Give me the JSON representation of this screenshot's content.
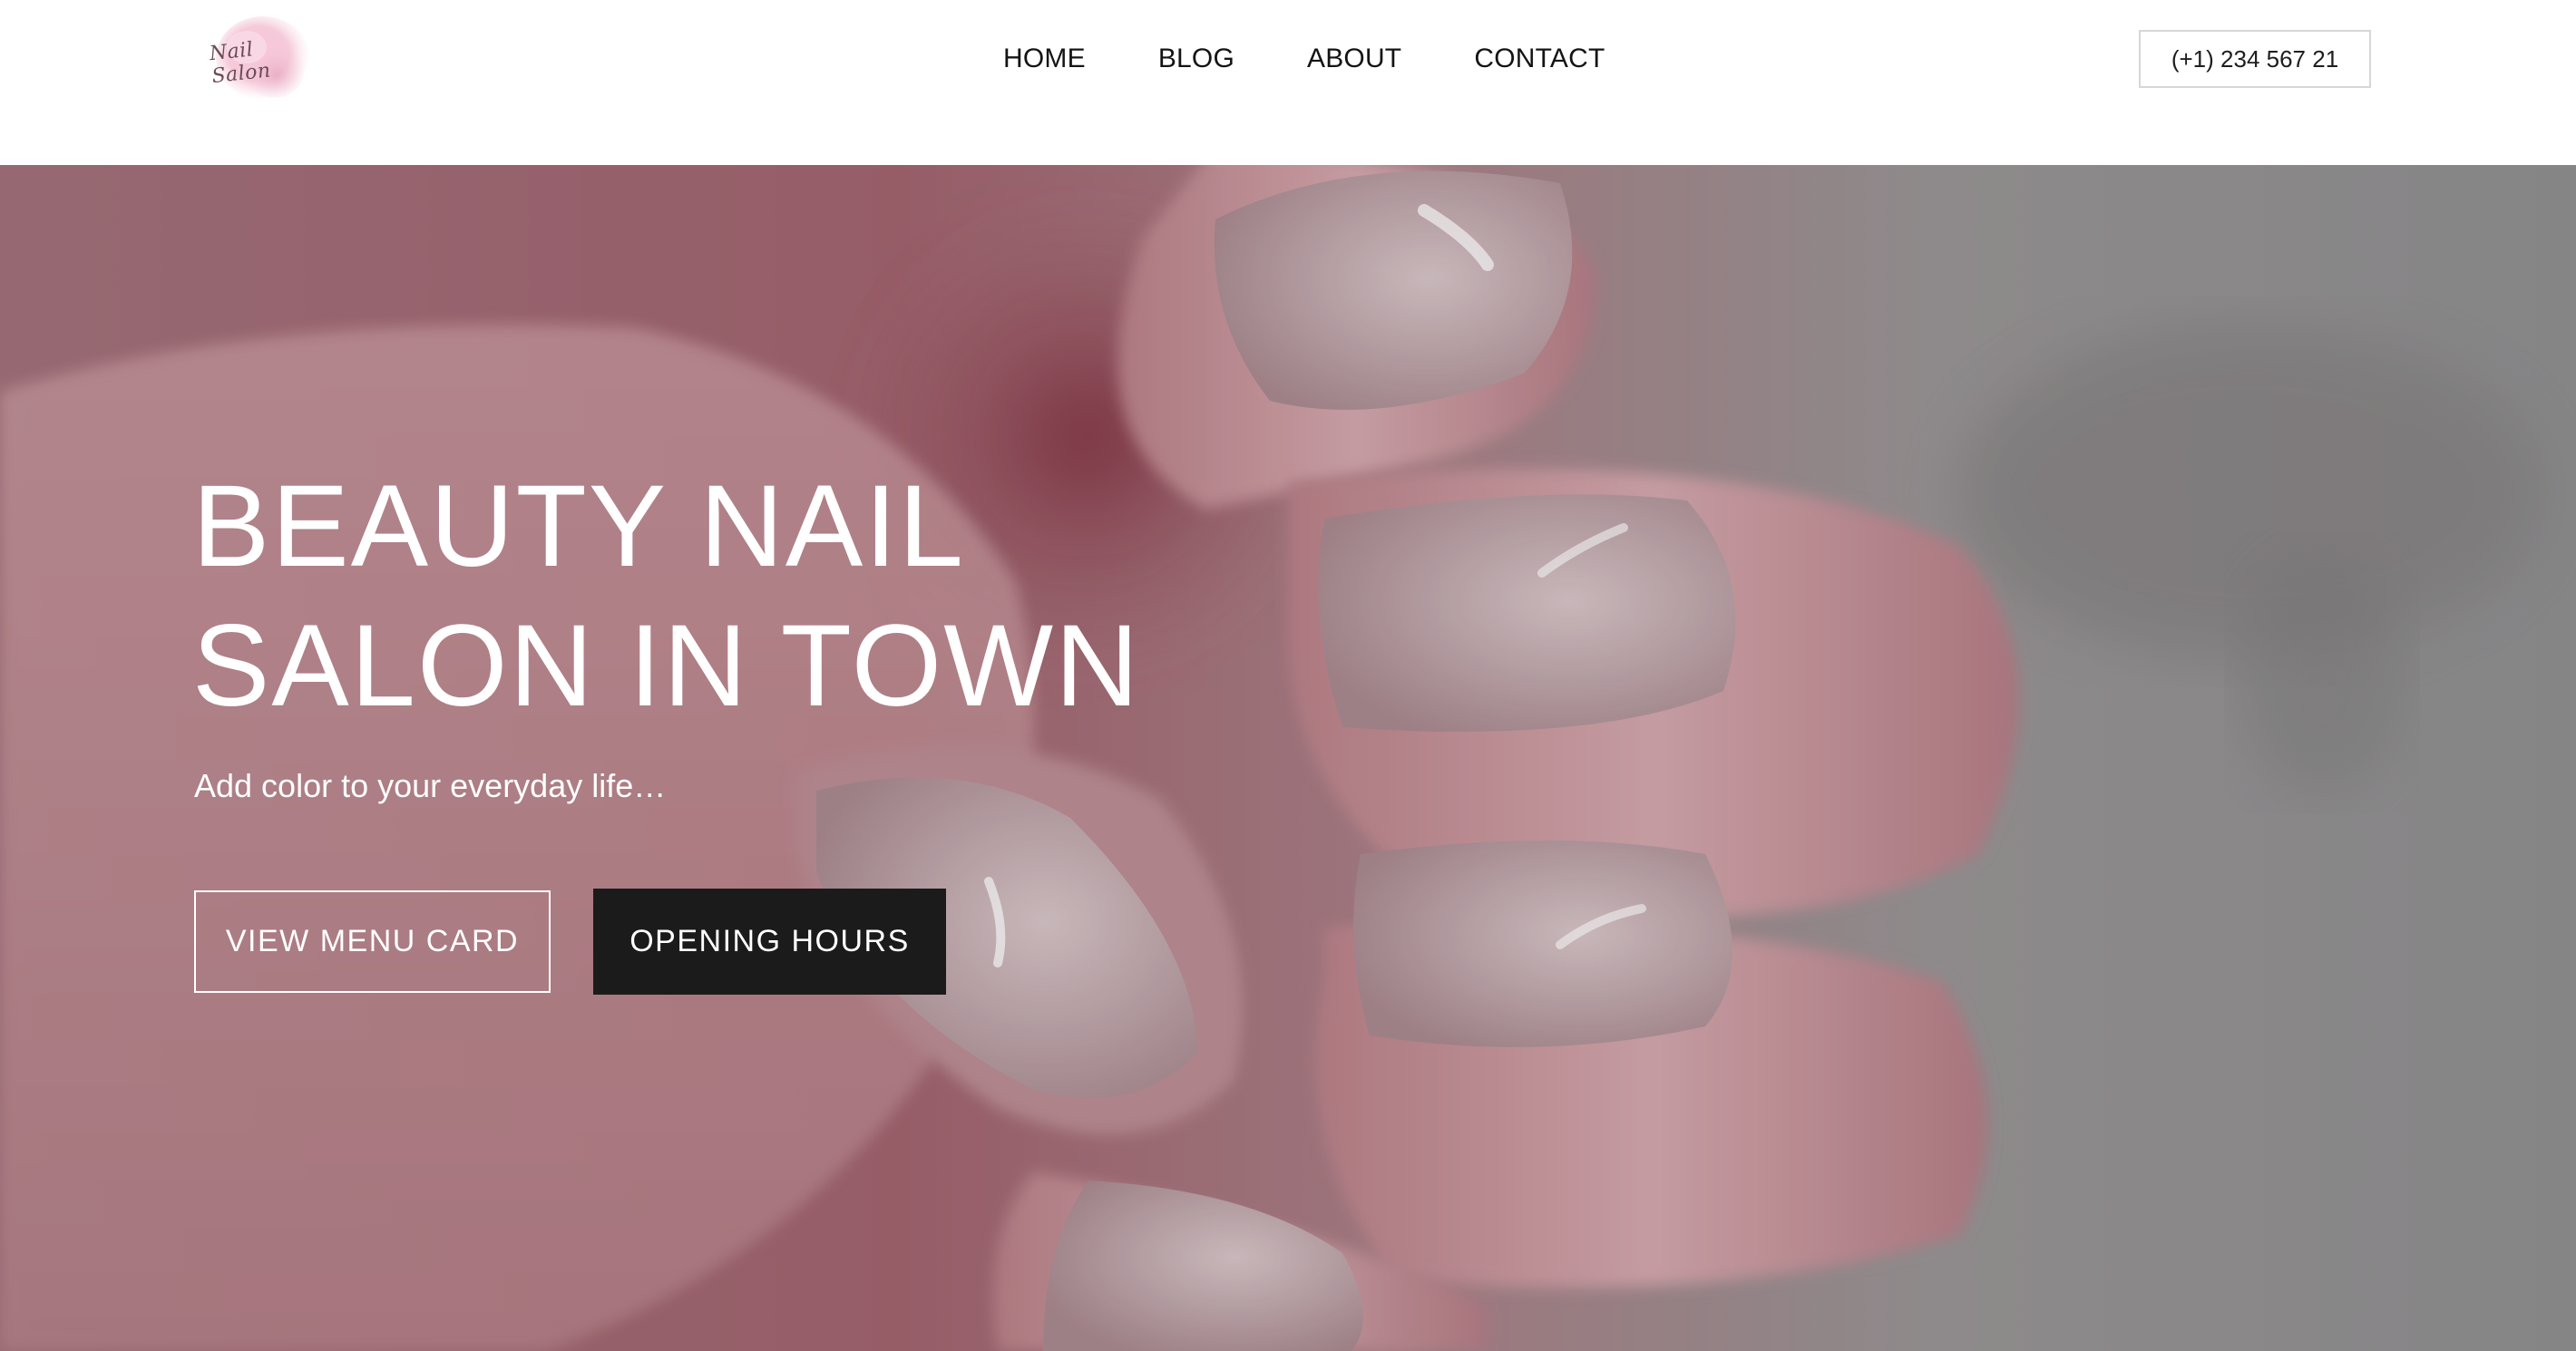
{
  "header": {
    "logo": {
      "text": "Nail Salon",
      "icon": "watercolor-blob-logo"
    },
    "nav": {
      "items": [
        {
          "label": "HOME"
        },
        {
          "label": "BLOG"
        },
        {
          "label": "ABOUT"
        },
        {
          "label": "CONTACT"
        }
      ]
    },
    "phone": {
      "label": "(+1) 234 567 21"
    }
  },
  "hero": {
    "title_line_1": "BEAUTY NAIL",
    "title_line_2": "SALON IN TOWN",
    "tagline": "Add color to your everyday life…",
    "primary_button": "VIEW MENU CARD",
    "secondary_button": "OPENING HOURS",
    "background": "photo of hand with glitter nude nails"
  },
  "colors": {
    "header_bg": "#ffffff",
    "nav_text": "#141414",
    "hero_text": "#ffffff",
    "solid_button_bg": "#1c1b1b",
    "phone_border": "#d7d7d7"
  }
}
